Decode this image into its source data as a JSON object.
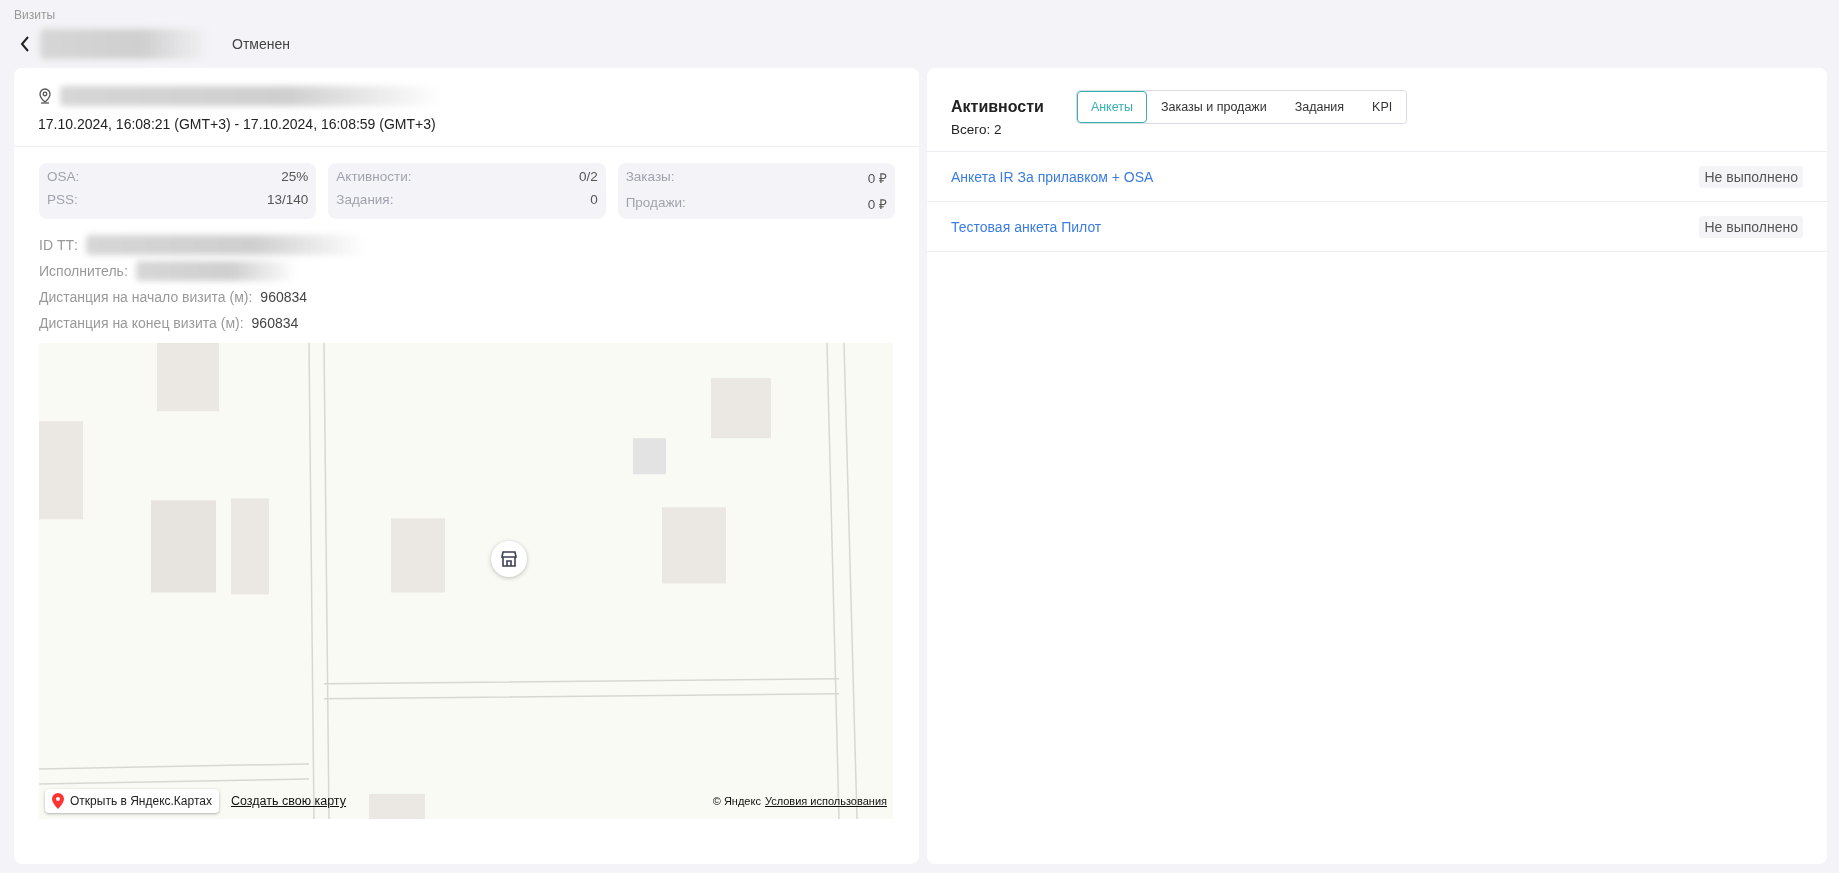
{
  "breadcrumb": "Визиты",
  "header": {
    "status": "Отменен"
  },
  "visit": {
    "period": "17.10.2024, 16:08:21 (GMT+3) - 17.10.2024, 16:08:59 (GMT+3)"
  },
  "stats": [
    {
      "rows": [
        {
          "label": "OSA:",
          "value": "25%"
        },
        {
          "label": "PSS:",
          "value": "13/140"
        }
      ]
    },
    {
      "rows": [
        {
          "label": "Активности:",
          "value": "0/2"
        },
        {
          "label": "Задания:",
          "value": "0"
        }
      ]
    },
    {
      "rows": [
        {
          "label": "Заказы:",
          "value": "0 ₽"
        },
        {
          "label": "Продажи:",
          "value": "0 ₽"
        }
      ]
    }
  ],
  "details": [
    {
      "kind": "redacted",
      "label": "ID ТТ:"
    },
    {
      "kind": "redacted",
      "label": "Исполнитель:"
    },
    {
      "kind": "value",
      "label": "Дистанция на начало визита (м):",
      "value": "960834"
    },
    {
      "kind": "value",
      "label": "Дистанция на конец визита (м):",
      "value": "960834"
    }
  ],
  "map": {
    "open_button": "Открыть в Яндекс.Картах",
    "create_link": "Создать свою карту",
    "copyright": "© Яндекс",
    "terms_link": "Условия использования"
  },
  "activities": {
    "title": "Активности",
    "total": "Всего: 2",
    "tabs": [
      {
        "label": "Анкеты",
        "selected": true
      },
      {
        "label": "Заказы и продажи",
        "selected": false
      },
      {
        "label": "Задания",
        "selected": false
      },
      {
        "label": "KPI",
        "selected": false
      }
    ],
    "rows": [
      {
        "name": "Анкета IR За прилавком + OSA",
        "status": "Не выполнено"
      },
      {
        "name": "Тестовая анкета Пилот",
        "status": "Не выполнено"
      }
    ]
  }
}
